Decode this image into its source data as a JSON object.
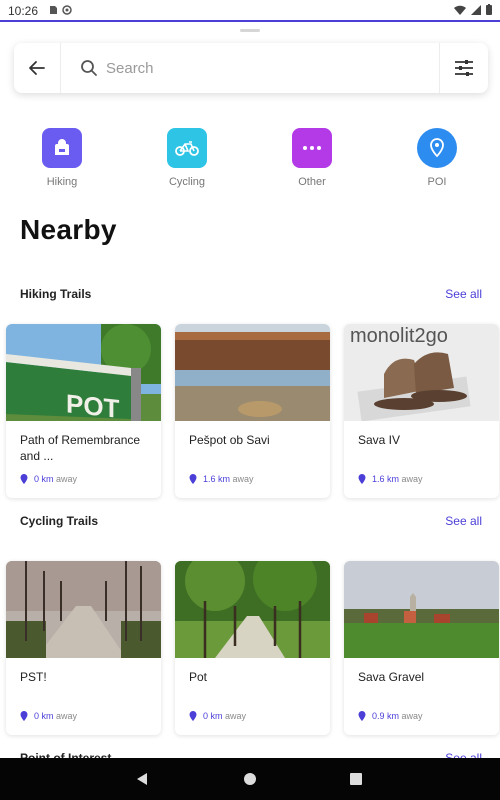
{
  "status_bar": {
    "time": "10:26"
  },
  "search": {
    "placeholder": "Search"
  },
  "categories": [
    {
      "label": "Hiking",
      "color": "#6a5cf0"
    },
    {
      "label": "Cycling",
      "color": "#2ec4e6"
    },
    {
      "label": "Other",
      "color": "#b33ae6"
    },
    {
      "label": "POI",
      "color": "#2d8cf0"
    }
  ],
  "page": {
    "title": "Nearby"
  },
  "sections": [
    {
      "title": "Hiking Trails",
      "see_all": "See all",
      "cards": [
        {
          "title": "Path of Remembrance and ...",
          "distance": "0 km",
          "suffix": "away"
        },
        {
          "title": "Pešpot ob Savi",
          "distance": "1.6 km",
          "suffix": "away"
        },
        {
          "title": "Sava IV",
          "distance": "1.6 km",
          "suffix": "away",
          "image_text": "monolit2go"
        }
      ]
    },
    {
      "title": "Cycling Trails",
      "see_all": "See all",
      "cards": [
        {
          "title": "PST!",
          "distance": "0 km",
          "suffix": "away"
        },
        {
          "title": "Pot",
          "distance": "0 km",
          "suffix": "away"
        },
        {
          "title": "Sava Gravel",
          "distance": "0.9 km",
          "suffix": "away"
        }
      ]
    },
    {
      "title": "Point of Interest",
      "see_all": "See all"
    }
  ],
  "colors": {
    "accent": "#4b3fd8",
    "nav_bar": "#050505"
  },
  "icons": {
    "back": "arrow-left-icon",
    "search": "search-icon",
    "filter": "sliders-icon",
    "pin": "location-pin-icon"
  }
}
